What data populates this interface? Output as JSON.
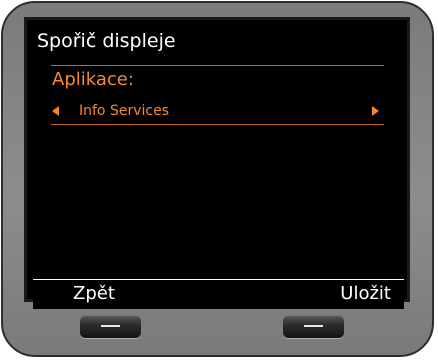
{
  "screen": {
    "title": "Spořič displeje",
    "field_label": "Aplikace:",
    "field_value": "Info Services"
  },
  "softkeys": {
    "left_label": "Zpět",
    "right_label": "Uložit"
  },
  "icons": {
    "prev_option": "left-arrow-icon",
    "next_option": "right-arrow-icon",
    "softkey_dash": "dash-icon"
  },
  "colors": {
    "accent": "#f5872d",
    "separator": "#c8641e",
    "screen_background": "#000000",
    "text": "#ffffff",
    "device_body": "#8d8d8d"
  }
}
